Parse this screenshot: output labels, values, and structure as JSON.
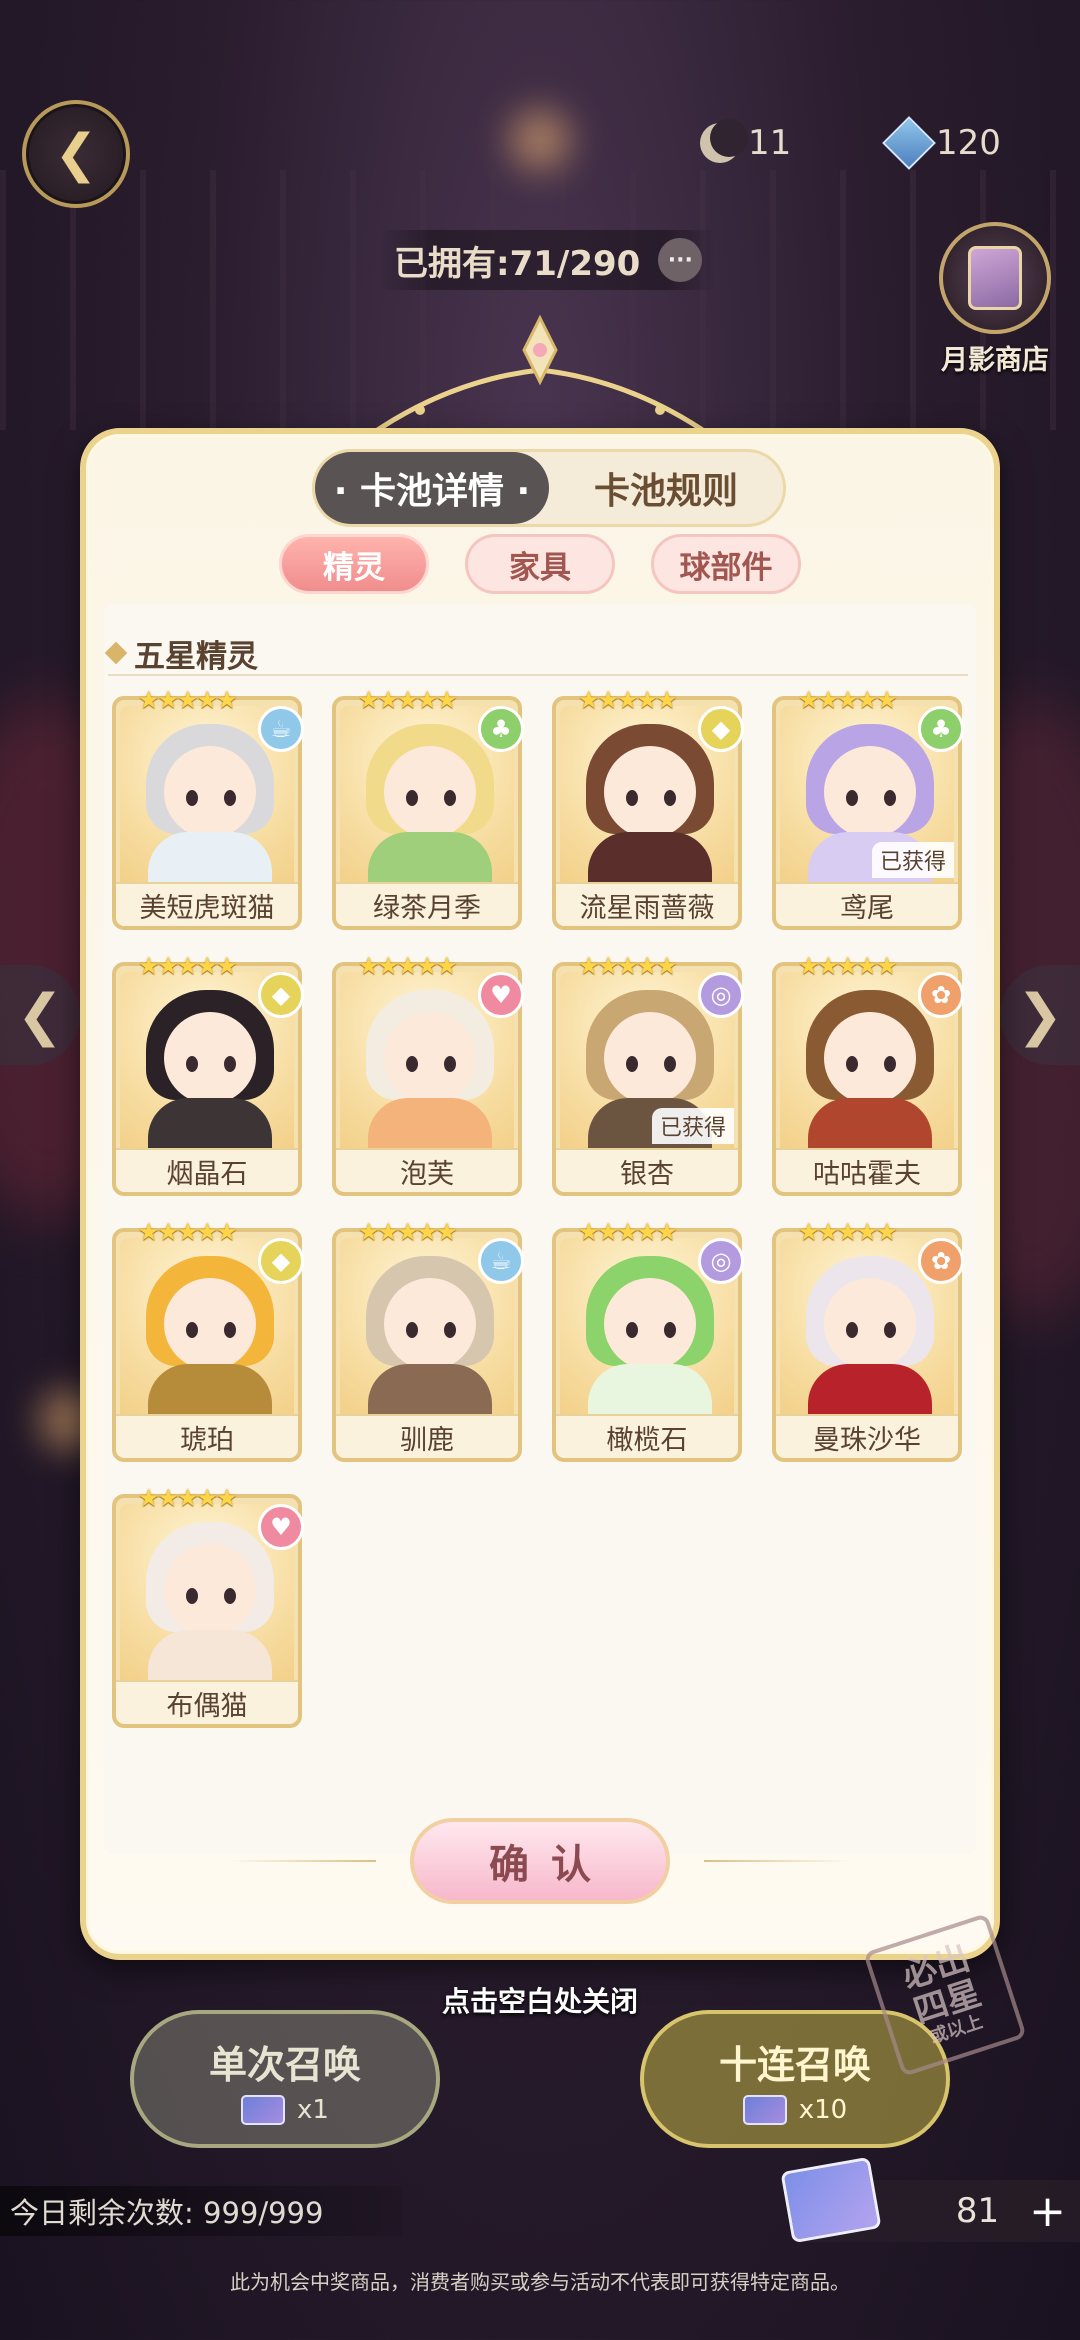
{
  "header": {
    "back_icon": "back-arrow-icon",
    "moon_currency": "11",
    "gem_currency": "120",
    "owned_text": "已拥有:71/290",
    "more_label": "···",
    "shop_label": "月影商店"
  },
  "panel": {
    "tabs": [
      {
        "label": "· 卡池详情 ·",
        "active": true
      },
      {
        "label": "卡池规则",
        "active": false
      }
    ],
    "sub_tabs": [
      {
        "label": "精灵",
        "active": true
      },
      {
        "label": "家具",
        "active": false
      },
      {
        "label": "球部件",
        "active": false
      }
    ],
    "section_title": "五星精灵",
    "stars": "★★★★★",
    "cards": [
      {
        "name": "美短虎斑猫",
        "badge": "☕",
        "badge_color": "#8fc8e8",
        "hair": "#d9d9dc",
        "body": "#e8f0f6",
        "obtained": ""
      },
      {
        "name": "绿茶月季",
        "badge": "♣",
        "badge_color": "#8dcf6a",
        "hair": "#f1db8a",
        "body": "#9fcf7a",
        "obtained": ""
      },
      {
        "name": "流星雨蔷薇",
        "badge": "◆",
        "badge_color": "#e6d35a",
        "hair": "#7a4a32",
        "body": "#5a2e2a",
        "obtained": ""
      },
      {
        "name": "鸢尾",
        "badge": "♣",
        "badge_color": "#8dcf6a",
        "hair": "#b9a5e6",
        "body": "#d9ccf3",
        "obtained": "已获得"
      },
      {
        "name": "烟晶石",
        "badge": "◆",
        "badge_color": "#e6d35a",
        "hair": "#2a2226",
        "body": "#3d3436",
        "obtained": ""
      },
      {
        "name": "泡芙",
        "badge": "♥",
        "badge_color": "#f08aa0",
        "hair": "#f3ede1",
        "body": "#f3b37a",
        "obtained": ""
      },
      {
        "name": "银杏",
        "badge": "◎",
        "badge_color": "#b49be0",
        "hair": "#c9a772",
        "body": "#6b5440",
        "obtained": "已获得"
      },
      {
        "name": "咕咕霍夫",
        "badge": "✿",
        "badge_color": "#f0a06a",
        "hair": "#8a5a32",
        "body": "#b0462e",
        "obtained": ""
      },
      {
        "name": "琥珀",
        "badge": "◆",
        "badge_color": "#e6d35a",
        "hair": "#f3b53a",
        "body": "#b68b3a",
        "obtained": ""
      },
      {
        "name": "驯鹿",
        "badge": "☕",
        "badge_color": "#8fc8e8",
        "hair": "#d7c6ae",
        "body": "#8a6a52",
        "obtained": ""
      },
      {
        "name": "橄榄石",
        "badge": "◎",
        "badge_color": "#b49be0",
        "hair": "#8bd36a",
        "body": "#e9f6df",
        "obtained": ""
      },
      {
        "name": "曼珠沙华",
        "badge": "✿",
        "badge_color": "#f0a06a",
        "hair": "#ece6ec",
        "body": "#b8232b",
        "obtained": ""
      },
      {
        "name": "布偶猫",
        "badge": "♥",
        "badge_color": "#f08aa0",
        "hair": "#f3ece6",
        "body": "#f5e6d8",
        "obtained": ""
      }
    ],
    "confirm_label": "确认"
  },
  "close_hint": "点击空白处关闭",
  "summon": {
    "single_label": "单次召唤",
    "single_cost": "x1",
    "ten_label": "十连召唤",
    "ten_cost": "x10",
    "promo_line1": "必出",
    "promo_line2": "四星",
    "promo_line3": "或以上"
  },
  "footer": {
    "daily_remaining": "今日剩余次数: 999/999",
    "ticket_count": "81",
    "plus_label": "+",
    "disclaimer": "此为机会中奖商品，消费者购买或参与活动不代表即可获得特定商品。"
  }
}
